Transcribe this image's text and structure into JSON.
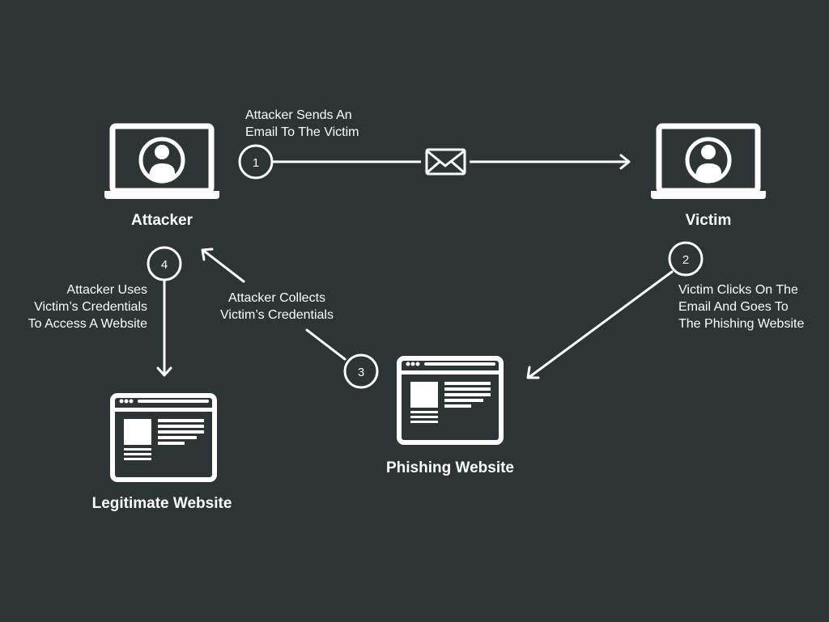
{
  "colors": {
    "background": "#2d3436",
    "foreground": "#ffffff"
  },
  "nodes": {
    "attacker": {
      "label": "Attacker",
      "icon": "laptop-user-icon"
    },
    "victim": {
      "label": "Victim",
      "icon": "laptop-user-icon"
    },
    "phishing": {
      "label": "Phishing Website",
      "icon": "browser-window-icon"
    },
    "legitimate": {
      "label": "Legitimate Website",
      "icon": "browser-window-icon"
    }
  },
  "steps": [
    {
      "number": "1",
      "lines": [
        "Attacker Sends An",
        "Email To The Victim"
      ]
    },
    {
      "number": "2",
      "lines": [
        "Victim Clicks On The",
        "Email And Goes To",
        "The Phishing Website"
      ]
    },
    {
      "number": "3",
      "lines": [
        "Attacker Collects",
        "Victim’s Credentials"
      ]
    },
    {
      "number": "4",
      "lines": [
        "Attacker Uses",
        "Victim’s Credentials",
        "To Access A Website"
      ]
    }
  ],
  "email_icon": "envelope-icon"
}
